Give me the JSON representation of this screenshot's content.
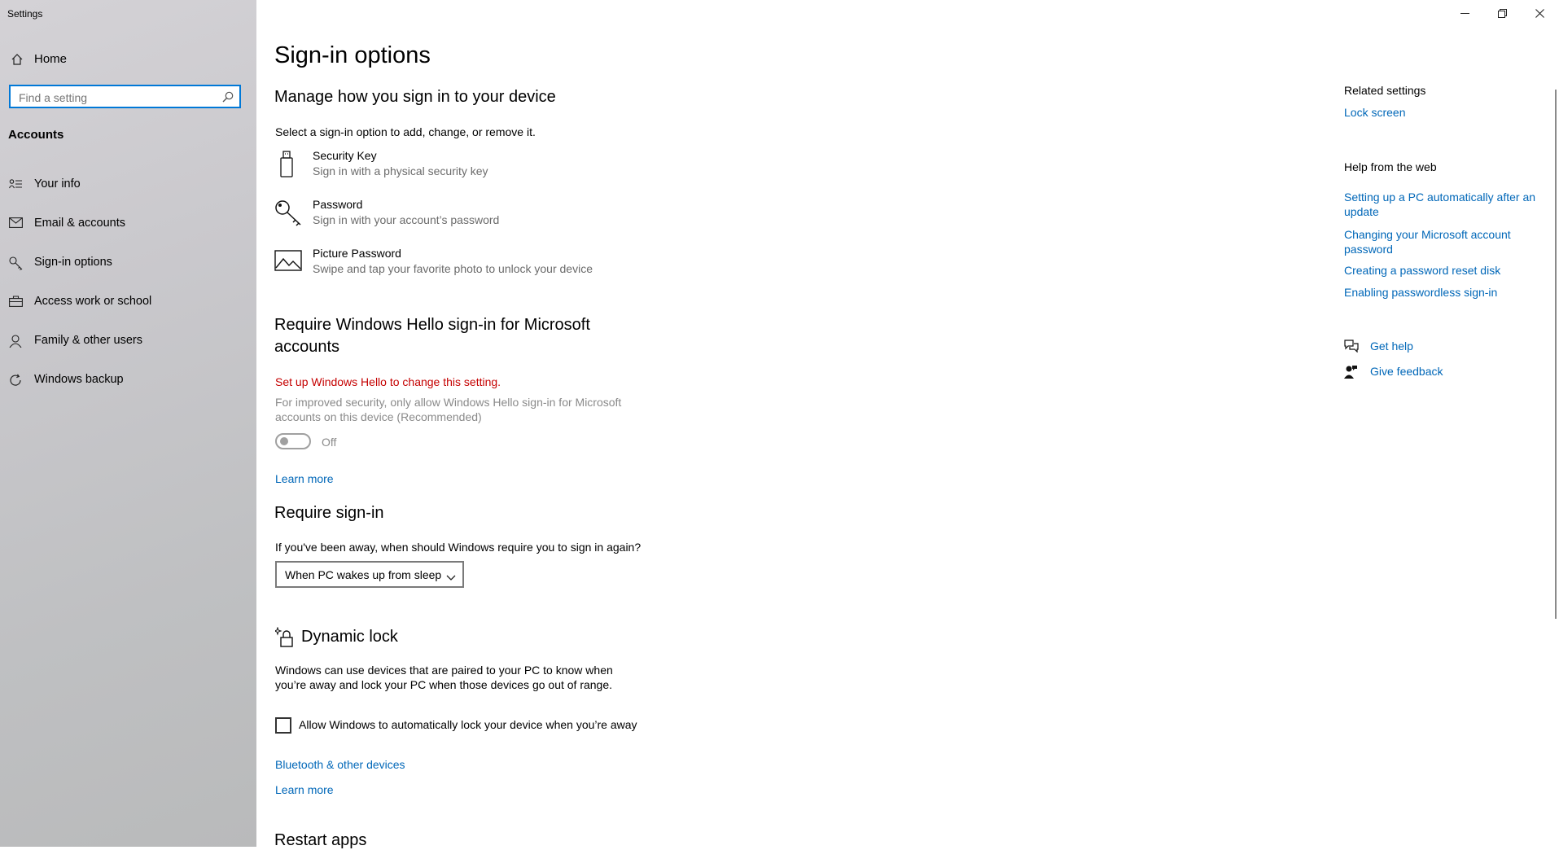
{
  "window": {
    "title": "Settings",
    "controls": {
      "minimize": "minimize",
      "restore": "restore",
      "close": "close"
    }
  },
  "sidebar": {
    "home_label": "Home",
    "search_placeholder": "Find a setting",
    "search_value": "",
    "section_title": "Accounts",
    "items": [
      {
        "label": "Your info",
        "icon": "person-card-icon"
      },
      {
        "label": "Email & accounts",
        "icon": "mail-icon"
      },
      {
        "label": "Sign-in options",
        "icon": "key-icon",
        "selected": true
      },
      {
        "label": "Access work or school",
        "icon": "briefcase-icon"
      },
      {
        "label": "Family & other users",
        "icon": "person-icon"
      },
      {
        "label": "Windows backup",
        "icon": "sync-icon"
      }
    ]
  },
  "main": {
    "page_title": "Sign-in options",
    "manage": {
      "heading": "Manage how you sign in to your device",
      "description": "Select a sign-in option to add, change, or remove it.",
      "options": [
        {
          "title": "Security Key",
          "subtitle": "Sign in with a physical security key",
          "icon": "usb-key-icon"
        },
        {
          "title": "Password",
          "subtitle": "Sign in with your account’s password",
          "icon": "key-icon"
        },
        {
          "title": "Picture Password",
          "subtitle": "Swipe and tap your favorite photo to unlock your device",
          "icon": "picture-icon"
        }
      ]
    },
    "hello": {
      "heading_line1": "Require Windows Hello sign-in for Microsoft",
      "heading_line2": "accounts",
      "warning": "Set up Windows Hello to change this setting.",
      "description_line1": "For improved security, only allow Windows Hello sign-in for Microsoft",
      "description_line2": "accounts on this device (Recommended)",
      "toggle_state": "Off",
      "learn_more": "Learn more"
    },
    "require_signin": {
      "heading": "Require sign-in",
      "question": "If you've been away, when should Windows require you to sign in again?",
      "selected": "When PC wakes up from sleep"
    },
    "dynamic_lock": {
      "heading": "Dynamic lock",
      "description_line1": "Windows can use devices that are paired to your PC to know when",
      "description_line2": "you’re away and lock your PC when those devices go out of range.",
      "checkbox_label": "Allow Windows to automatically lock your device when you’re away",
      "checked": false,
      "bluetooth_link": "Bluetooth & other devices",
      "learn_more": "Learn more"
    },
    "restart_apps": {
      "heading": "Restart apps"
    }
  },
  "related": {
    "heading": "Related settings",
    "lock_screen": "Lock screen",
    "help_heading": "Help from the web",
    "help_links": [
      {
        "line1": "Setting up a PC automatically after an",
        "line2": "update"
      },
      {
        "line1": "Changing your Microsoft account",
        "line2": "password"
      },
      {
        "line1": "Creating a password reset disk",
        "line2": ""
      },
      {
        "line1": "Enabling passwordless sign-in",
        "line2": ""
      }
    ],
    "get_help": "Get help",
    "give_feedback": "Give feedback"
  },
  "colors": {
    "accent": "#0078d7",
    "link": "#0067b8",
    "warning": "#c50000"
  }
}
